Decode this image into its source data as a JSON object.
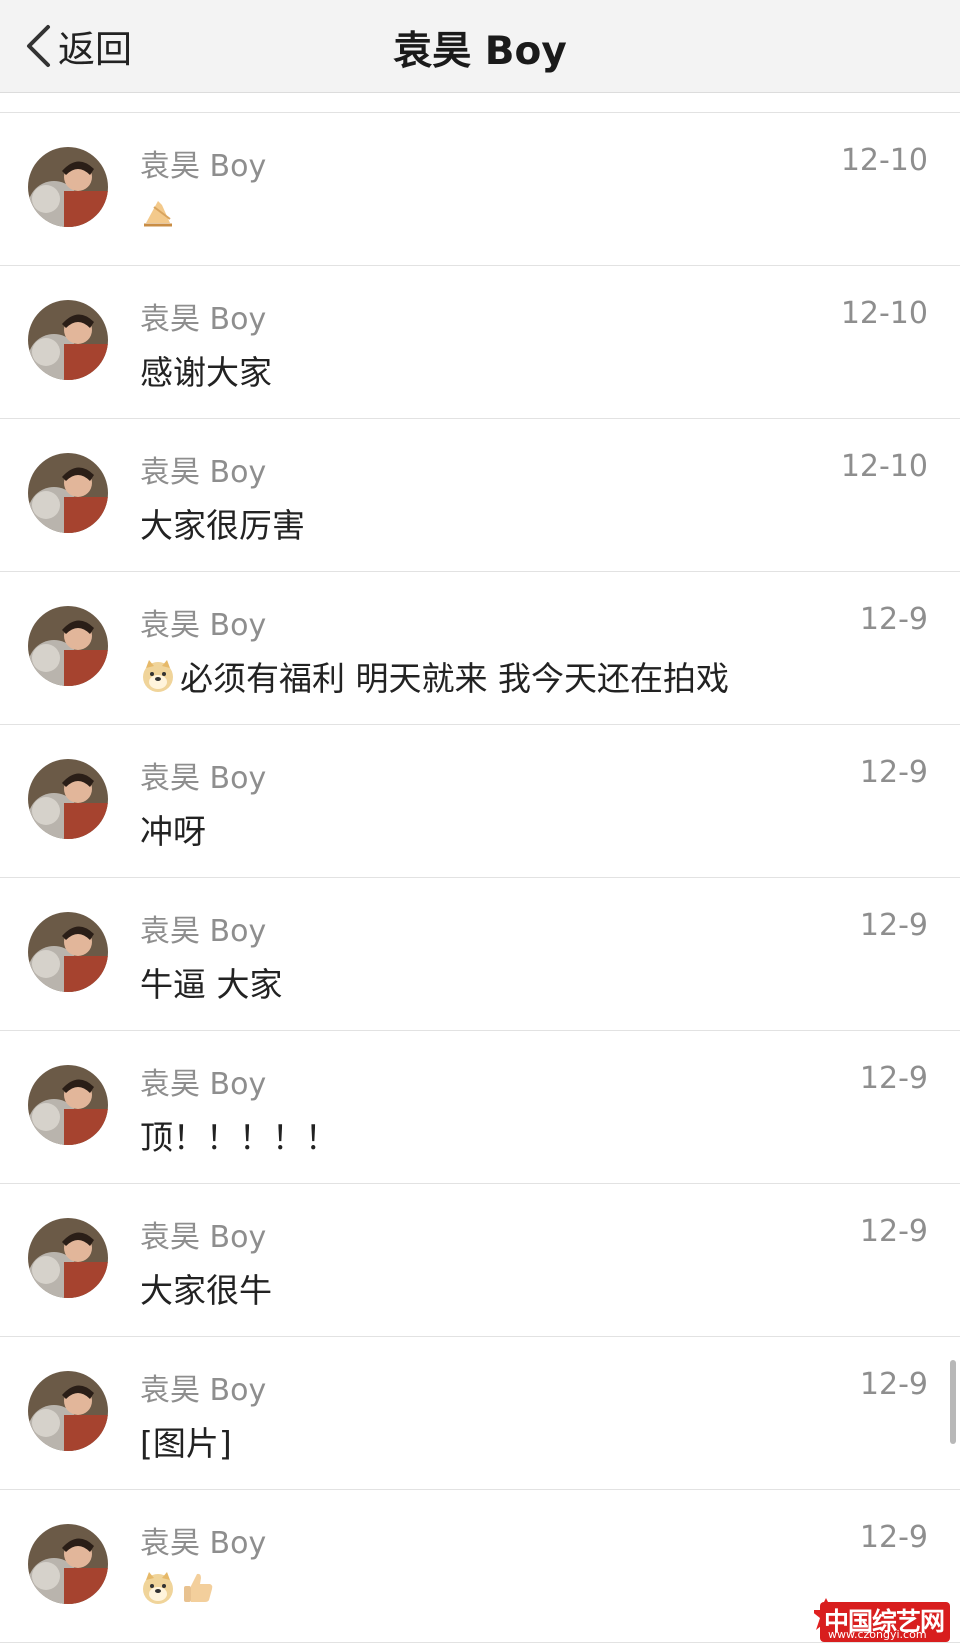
{
  "navbar": {
    "back_label": "返回",
    "title": "袁昊 Boy"
  },
  "conversations": [
    {
      "sender": "袁昊 Boy",
      "date": "12-10",
      "text": "",
      "emojis": [
        "pray-hands-emoji"
      ]
    },
    {
      "sender": "袁昊 Boy",
      "date": "12-10",
      "text": "感谢大家",
      "emojis": []
    },
    {
      "sender": "袁昊 Boy",
      "date": "12-10",
      "text": "大家很厉害",
      "emojis": []
    },
    {
      "sender": "袁昊 Boy",
      "date": "12-9",
      "text": "必须有福利 明天就来 我今天还在拍戏",
      "emojis": [
        "doge-emoji"
      ]
    },
    {
      "sender": "袁昊 Boy",
      "date": "12-9",
      "text": "冲呀",
      "emojis": []
    },
    {
      "sender": "袁昊 Boy",
      "date": "12-9",
      "text": "牛逼 大家",
      "emojis": []
    },
    {
      "sender": "袁昊 Boy",
      "date": "12-9",
      "text": "顶！！！！！",
      "emojis": []
    },
    {
      "sender": "袁昊 Boy",
      "date": "12-9",
      "text": "大家很牛",
      "emojis": []
    },
    {
      "sender": "袁昊 Boy",
      "date": "12-9",
      "text": "[图片]",
      "emojis": []
    },
    {
      "sender": "袁昊 Boy",
      "date": "12-9",
      "text": "",
      "emojis": [
        "doge-emoji",
        "thumbs-up-emoji"
      ]
    }
  ],
  "watermark": {
    "text": "中国综艺网",
    "url": "www.czongyi.com"
  }
}
